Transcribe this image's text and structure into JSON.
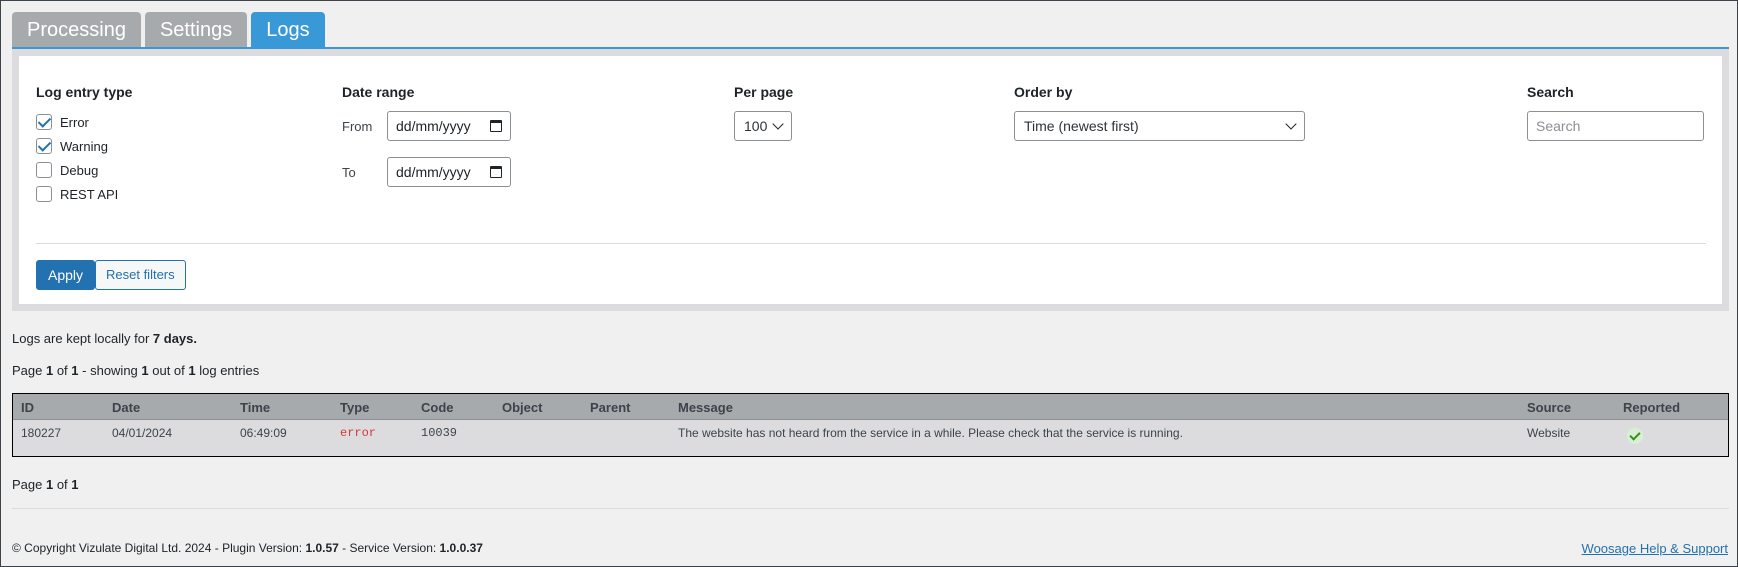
{
  "tabs": [
    {
      "label": "Processing",
      "active": false
    },
    {
      "label": "Settings",
      "active": false
    },
    {
      "label": "Logs",
      "active": true
    }
  ],
  "filters": {
    "log_entry_type": {
      "label": "Log entry type",
      "options": [
        {
          "label": "Error",
          "checked": true
        },
        {
          "label": "Warning",
          "checked": true
        },
        {
          "label": "Debug",
          "checked": false
        },
        {
          "label": "REST API",
          "checked": false
        }
      ]
    },
    "date_range": {
      "label": "Date range",
      "from_label": "From",
      "to_label": "To",
      "from_placeholder": "dd/mm/yyyy",
      "to_placeholder": "dd/mm/yyyy"
    },
    "per_page": {
      "label": "Per page",
      "value": "100"
    },
    "order_by": {
      "label": "Order by",
      "value": "Time (newest first)"
    },
    "search": {
      "label": "Search",
      "placeholder": "Search"
    },
    "apply_label": "Apply",
    "reset_label": "Reset filters"
  },
  "retention": {
    "prefix": "Logs are kept locally for ",
    "value": "7 days."
  },
  "paging_top": {
    "p1": "Page ",
    "page": "1",
    "p2": " of ",
    "total_pages": "1",
    "p3": " - showing ",
    "shown": "1",
    "p4": " out of ",
    "total": "1",
    "p5": " log entries"
  },
  "table": {
    "headers": [
      "ID",
      "Date",
      "Time",
      "Type",
      "Code",
      "Object",
      "Parent",
      "Message",
      "Source",
      "Reported"
    ],
    "rows": [
      {
        "id": "180227",
        "date": "04/01/2024",
        "time": "06:49:09",
        "type": "error",
        "code": "10039",
        "object": "",
        "parent": "",
        "message": "The website has not heard from the service in a while. Please check that the service is running.",
        "source": "Website",
        "reported_icon": "check-icon"
      }
    ]
  },
  "paging_bottom": {
    "p1": "Page ",
    "page": "1",
    "p2": " of ",
    "total_pages": "1"
  },
  "footer": {
    "copyright": "© Copyright Vizulate Digital Ltd. 2024 - Plugin Version: ",
    "plugin_version": "1.0.57",
    "service_label": " - Service Version: ",
    "service_version": "1.0.0.37",
    "help_link": "Woosage Help & Support"
  },
  "colors": {
    "accent": "#3899d6",
    "primary_button": "#2271b1",
    "error_text": "#d63638",
    "success": "#3a8f1f"
  }
}
